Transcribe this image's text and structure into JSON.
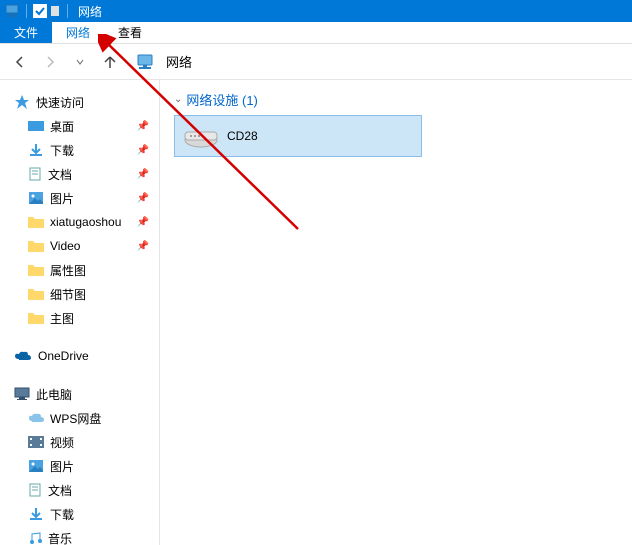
{
  "titlebar": {
    "title": "网络"
  },
  "ribbon": {
    "file": "文件",
    "network": "网络",
    "view": "查看"
  },
  "address": {
    "location": "网络"
  },
  "sidebar": {
    "quick_access": "快速访问",
    "quick_items": [
      {
        "label": "桌面",
        "icon": "desktop"
      },
      {
        "label": "下载",
        "icon": "download"
      },
      {
        "label": "文档",
        "icon": "document"
      },
      {
        "label": "图片",
        "icon": "picture"
      },
      {
        "label": "xiatugaoshou",
        "icon": "folder"
      },
      {
        "label": "Video",
        "icon": "folder"
      },
      {
        "label": "属性图",
        "icon": "folder"
      },
      {
        "label": "细节图",
        "icon": "folder"
      },
      {
        "label": "主图",
        "icon": "folder"
      }
    ],
    "onedrive": "OneDrive",
    "thispc": "此电脑",
    "pc_items": [
      {
        "label": "WPS网盘",
        "icon": "cloud"
      },
      {
        "label": "视频",
        "icon": "video"
      },
      {
        "label": "图片",
        "icon": "picture"
      },
      {
        "label": "文档",
        "icon": "document"
      },
      {
        "label": "下载",
        "icon": "download"
      },
      {
        "label": "音乐",
        "icon": "music"
      }
    ]
  },
  "content": {
    "section_header": "网络设施 (1)",
    "devices": [
      {
        "name": "CD28"
      }
    ]
  }
}
